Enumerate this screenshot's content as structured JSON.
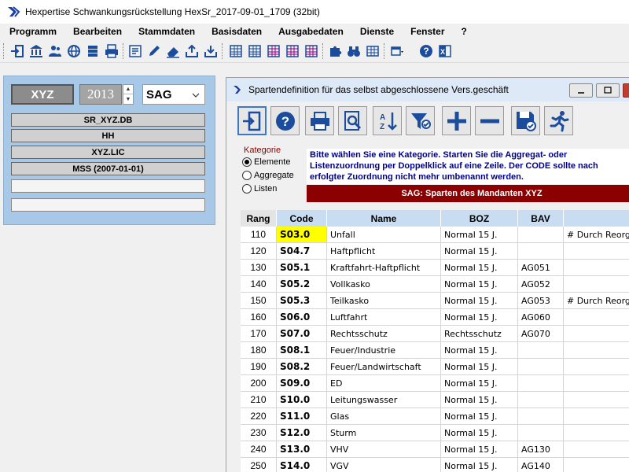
{
  "window": {
    "title": "Hexpertise Schwankungsrückstellung HexSr_2017-09-01_1709 (32bit)"
  },
  "menu": [
    "Programm",
    "Bearbeiten",
    "Stammdaten",
    "Basisdaten",
    "Ausgabedaten",
    "Dienste",
    "Fenster",
    "?"
  ],
  "left_panel": {
    "company": "XYZ",
    "year": "2013",
    "mode": "SAG",
    "fields": [
      "SR_XYZ.DB",
      "HH",
      "XYZ.LIC",
      "MSS (2007-01-01)",
      "",
      ""
    ]
  },
  "child_window": {
    "title": "Spartendefinition für das selbst abgeschlossene Vers.geschäft",
    "kategorie": {
      "label": "Kategorie",
      "options": [
        "Elemente",
        "Aggregate",
        "Listen"
      ],
      "selected": "Elemente"
    },
    "info_text": "Bitte wählen Sie eine Kategorie. Starten Sie die Aggregat- oder Listenzuordnung per Doppelklick auf eine Zeile. Der CODE sollte nach erfolgter Zuordnung nicht mehr umbenannt werden.",
    "banner": "SAG: Sparten des Mandanten XYZ",
    "table": {
      "columns": [
        "Rang",
        "Code",
        "Name",
        "BOZ",
        "BAV",
        ""
      ],
      "rows": [
        [
          "110",
          "S03.0",
          "Unfall",
          "Normal 15 J.",
          "",
          "# Durch Reorg"
        ],
        [
          "120",
          "S04.7",
          "Haftpflicht",
          "Normal 15 J.",
          "",
          ""
        ],
        [
          "130",
          "S05.1",
          "Kraftfahrt-Haftpflicht",
          "Normal 15 J.",
          "AG051",
          ""
        ],
        [
          "140",
          "S05.2",
          "Vollkasko",
          "Normal 15 J.",
          "AG052",
          ""
        ],
        [
          "150",
          "S05.3",
          "Teilkasko",
          "Normal 15 J.",
          "AG053",
          "# Durch Reorg"
        ],
        [
          "160",
          "S06.0",
          "Luftfahrt",
          "Normal 15 J.",
          "AG060",
          ""
        ],
        [
          "170",
          "S07.0",
          "Rechtsschutz",
          "Rechtsschutz",
          "AG070",
          ""
        ],
        [
          "180",
          "S08.1",
          "Feuer/Industrie",
          "Normal 15 J.",
          "",
          ""
        ],
        [
          "190",
          "S08.2",
          "Feuer/Landwirtschaft",
          "Normal 15 J.",
          "",
          ""
        ],
        [
          "200",
          "S09.0",
          "ED",
          "Normal 15 J.",
          "",
          ""
        ],
        [
          "210",
          "S10.0",
          "Leitungswasser",
          "Normal 15 J.",
          "",
          ""
        ],
        [
          "220",
          "S11.0",
          "Glas",
          "Normal 15 J.",
          "",
          ""
        ],
        [
          "230",
          "S12.0",
          "Sturm",
          "Normal 15 J.",
          "",
          ""
        ],
        [
          "240",
          "S13.0",
          "VHV",
          "Normal 15 J.",
          "AG130",
          ""
        ],
        [
          "250",
          "S14.0",
          "VGV",
          "Normal 15 J.",
          "AG140",
          ""
        ]
      ],
      "highlight_color": "#ffff00"
    }
  },
  "colors": {
    "panel_blue": "#a8c8e8",
    "header_blue": "#c8ddf2",
    "banner_red": "#8b0000",
    "info_blue": "#00008b"
  }
}
